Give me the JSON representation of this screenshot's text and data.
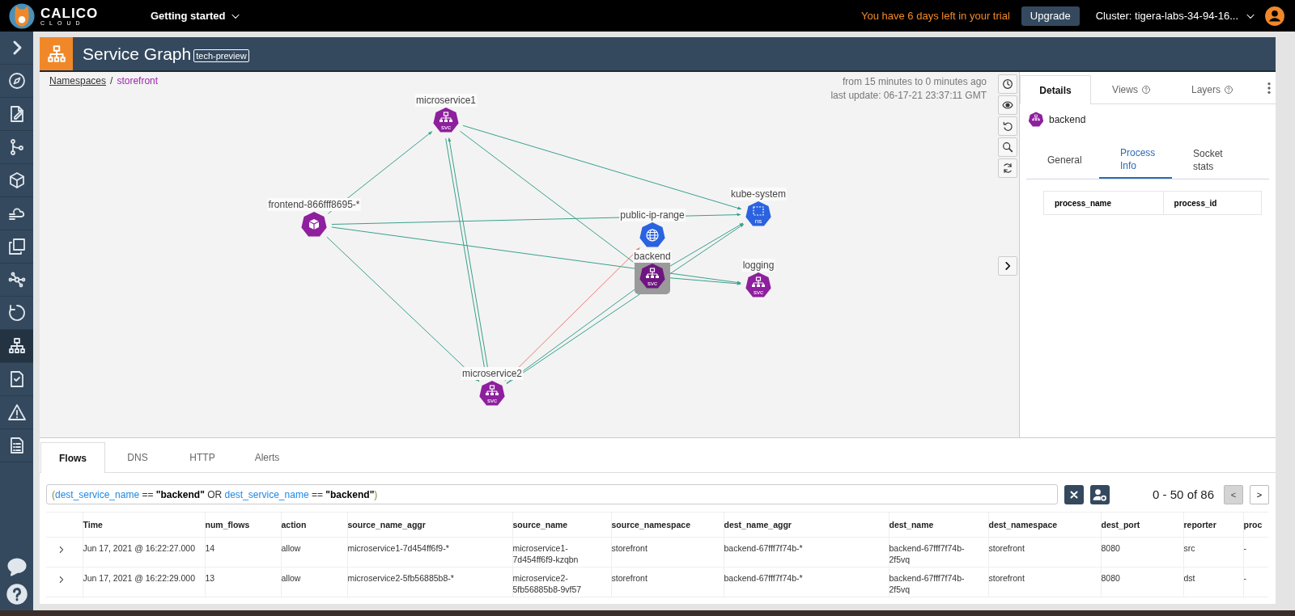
{
  "topbar": {
    "logo_title": "CALICO",
    "logo_subtitle": "CLOUD",
    "menu": "Getting started",
    "trial_notice": "You have 6 days left in your trial",
    "upgrade_button": "Upgrade",
    "cluster": "Cluster: tigera-labs-34-94-16..."
  },
  "sidebar": {
    "items": [
      {
        "kind": "expand",
        "selected": false
      },
      {
        "kind": "compass",
        "selected": false
      },
      {
        "kind": "edit",
        "selected": false
      },
      {
        "kind": "branch",
        "selected": false
      },
      {
        "kind": "cube",
        "selected": false
      },
      {
        "kind": "cloud",
        "selected": false
      },
      {
        "kind": "layers",
        "selected": false
      },
      {
        "kind": "network",
        "selected": false
      },
      {
        "kind": "cycle",
        "selected": false
      },
      {
        "kind": "hierarchy",
        "selected": true
      },
      {
        "kind": "checklist",
        "selected": false
      },
      {
        "kind": "warning",
        "selected": false
      },
      {
        "kind": "list",
        "selected": false
      }
    ],
    "bottom_items": [
      {
        "kind": "chat"
      },
      {
        "kind": "help"
      }
    ]
  },
  "header": {
    "title": "Service Graph",
    "badge": "tech-preview"
  },
  "breadcrumb": [
    {
      "label": "Namespaces",
      "kind": "link"
    },
    {
      "label": "/",
      "kind": "separator"
    },
    {
      "label": "storefront",
      "kind": "current"
    }
  ],
  "time_range": "from 15 minutes to 0 minutes ago",
  "last_update": "last update: 06-17-21 23:37:11 GMT",
  "graph": {
    "nodes": [
      {
        "label": "microservice1",
        "kind": "service",
        "badge": "svc",
        "selected": false
      },
      {
        "label": "frontend-866fff8695-*",
        "kind": "pod",
        "selected": false
      },
      {
        "label": "public-ip-range",
        "kind": "network",
        "selected": false
      },
      {
        "label": "backend",
        "kind": "service",
        "badge": "svc",
        "selected": true
      },
      {
        "label": "kube-system",
        "kind": "namespace",
        "badge": "ns",
        "selected": false
      },
      {
        "label": "logging",
        "kind": "service",
        "badge": "svc",
        "selected": false
      },
      {
        "label": "microservice2",
        "kind": "service",
        "badge": "svc",
        "selected": false
      }
    ],
    "edges": [
      {
        "kind": "allow"
      },
      {
        "kind": "allow"
      },
      {
        "kind": "allow"
      },
      {
        "kind": "allow"
      },
      {
        "kind": "allow"
      },
      {
        "kind": "allow"
      },
      {
        "kind": "allow"
      },
      {
        "kind": "allow"
      },
      {
        "kind": "deny"
      },
      {
        "kind": "allow"
      },
      {
        "kind": "allow"
      },
      {
        "kind": "allow"
      },
      {
        "kind": "allow"
      }
    ]
  },
  "details_panel": {
    "tabs": [
      {
        "label": "Details",
        "help": false,
        "selected": true
      },
      {
        "label": "Views",
        "help": true,
        "selected": false
      },
      {
        "label": "Layers",
        "help": true,
        "selected": false
      }
    ],
    "node": {
      "label": "backend",
      "kind": "service"
    },
    "subtabs": [
      {
        "label": "General",
        "selected": false
      },
      {
        "label": "Process Info",
        "selected": true
      },
      {
        "label": "Socket stats",
        "selected": false
      }
    ],
    "table": {
      "columns": [
        "process_name",
        "process_id"
      ]
    }
  },
  "flows_panel": {
    "tabs": [
      {
        "label": "Flows",
        "selected": true
      },
      {
        "label": "DNS",
        "selected": false
      },
      {
        "label": "HTTP",
        "selected": false
      },
      {
        "label": "Alerts",
        "selected": false
      }
    ],
    "filter": [
      {
        "text": "(",
        "kind": "paren"
      },
      {
        "text": "dest_service_name",
        "kind": "field"
      },
      {
        "text": " == ",
        "kind": "operator"
      },
      {
        "text": "\"backend\"",
        "kind": "value"
      },
      {
        "text": " OR ",
        "kind": "operator"
      },
      {
        "text": "dest_service_name",
        "kind": "field"
      },
      {
        "text": " == ",
        "kind": "operator"
      },
      {
        "text": "\"backend\"",
        "kind": "value"
      },
      {
        "text": ")",
        "kind": "paren"
      }
    ],
    "pagination": "0 - 50 of 86",
    "prev_button": {
      "label": "<",
      "disabled": true
    },
    "next_button": {
      "label": ">",
      "disabled": false
    },
    "table": {
      "columns": [
        "Time",
        "num_flows",
        "action",
        "source_name_aggr",
        "source_name",
        "source_namespace",
        "dest_name_aggr",
        "dest_name",
        "dest_namespace",
        "dest_port",
        "reporter",
        "proc"
      ],
      "rows": [
        [
          "Jun 17, 2021 @ 16:22:27.000",
          "14",
          "allow",
          "microservice1-7d454ff6f9-*",
          "microservice1-7d454ff6f9-kzqbn",
          "storefront",
          "backend-67fff7f74b-*",
          "backend-67fff7f74b-2f5vq",
          "storefront",
          "8080",
          "src",
          "-"
        ],
        [
          "Jun 17, 2021 @ 16:22:29.000",
          "13",
          "allow",
          "microservice2-5fb56885b8-*",
          "microservice2-5fb56885b8-9vf57",
          "storefront",
          "backend-67fff7f74b-*",
          "backend-67fff7f74b-2f5vq",
          "storefront",
          "8080",
          "dst",
          "-"
        ]
      ]
    }
  }
}
